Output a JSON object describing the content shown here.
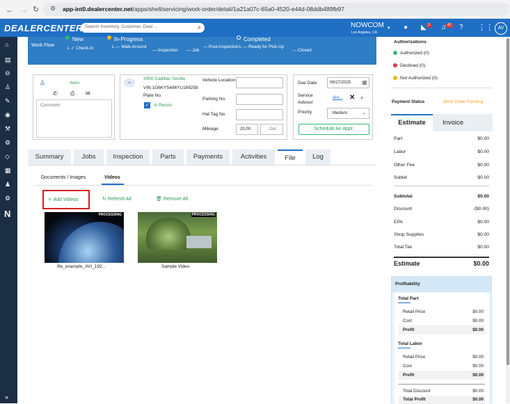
{
  "browser": {
    "url_host": "app-int0.dealercenter.net",
    "url_path": "/apps/shell/servicing/work-order/detail/1a21a07c-65a0-4520-e44d-08ddb489fb97"
  },
  "header": {
    "logo": "DEALERCENTER",
    "search_placeholder": "Search Inventory, Customer, Deal ...",
    "dealer_name": "NOWCOM",
    "dealer_location": "Los Angeles, CA",
    "notif_badge_1": "1",
    "notif_badge_2": "42",
    "avatar": "AV",
    "brand_color": "#1f6fc4"
  },
  "workflow": {
    "label": "Work Flow",
    "status_new": "New",
    "status_in_progress": "In-Progress",
    "status_completed": "Completed",
    "steps": [
      "Check-In",
      "Walk-Around",
      "Inspection",
      "Job",
      "Post-Inspection",
      "Ready for Pick-Up",
      "Closed"
    ]
  },
  "customer": {
    "name": "Alvin",
    "comment_placeholder": "Comment"
  },
  "vehicle": {
    "title": "2000 Cadillac Seville",
    "vin": "VIN 1G6KY5496YU169258",
    "plate": "Plate No.",
    "in_recon": "In Recon",
    "vehicle_location_label": "Vehicle Location",
    "parking_label": "Parking No.",
    "hat_tag_label": "Hat Tag No.",
    "mileage_label": "Mileage",
    "mileage_value": "20,00",
    "mileage_unit": "Out"
  },
  "due": {
    "due_label": "Due Date",
    "due_value": "06/27/2025",
    "advisor_label": "Service Advisor",
    "advisor_value": "Alvi...",
    "priority_label": "Priority",
    "priority_value": "Medium",
    "schedule_button": "Schedule An Appt."
  },
  "tabs": [
    "Summary",
    "Jobs",
    "Inspection",
    "Parts",
    "Payments",
    "Activities",
    "File",
    "Log"
  ],
  "file": {
    "subtabs": [
      "Documents / Images",
      "Videos"
    ],
    "add_videos": "Add Videos",
    "refresh_all": "Refresh All",
    "remove_all": "Remove All",
    "videos": [
      {
        "name": "file_example_AVI_192...",
        "status": "PROCESSING"
      },
      {
        "name": "Sample Video",
        "status": "PROCESSING"
      }
    ]
  },
  "authorizations": {
    "title": "Authorizations",
    "items": [
      {
        "label": "Authorized (0)",
        "color": "#2eb872"
      },
      {
        "label": "Declined (0)",
        "color": "#e53935"
      },
      {
        "label": "Not Authorized (0)",
        "color": "#f5b400"
      }
    ]
  },
  "payment": {
    "label": "Payment Status",
    "value": "Work Order Pending",
    "value_color": "#f5a623"
  },
  "estimate_tabs": [
    "Estimate",
    "Invoice"
  ],
  "estimate": {
    "rows": [
      {
        "label": "Part",
        "value": "$0.00"
      },
      {
        "label": "Labor",
        "value": "$0.00"
      },
      {
        "label": "Other Fee",
        "value": "$0.00"
      },
      {
        "label": "Sublet",
        "value": "$0.00"
      }
    ],
    "subtotal_label": "Subtotal",
    "subtotal_value": "$0.00",
    "rows2": [
      {
        "label": "Discount",
        "value": "($0.00)"
      },
      {
        "label": "EPA",
        "value": "$0.00"
      },
      {
        "label": "Shop Supplies",
        "value": "$0.00"
      },
      {
        "label": "Total Tax",
        "value": "$0.00"
      }
    ],
    "total_label": "Estimate",
    "total_value": "$0.00"
  },
  "profitability": {
    "title": "Profitability",
    "total_part": "Total Part",
    "part_rows": [
      {
        "label": "Retail Price",
        "value": "$0.00"
      },
      {
        "label": "Cost",
        "value": "$0.00"
      },
      {
        "label": "Profit",
        "value": "$0.00"
      }
    ],
    "total_labor": "Total Labor",
    "labor_rows": [
      {
        "label": "Retail Price",
        "value": "$0.00"
      },
      {
        "label": "Cost",
        "value": "$0.00"
      },
      {
        "label": "Profit",
        "value": "$0.00"
      }
    ],
    "total_discount_label": "Total Discount",
    "total_discount_value": "$0.00",
    "total_profit_label": "Total Profit",
    "total_profit_value": "$0.00"
  }
}
